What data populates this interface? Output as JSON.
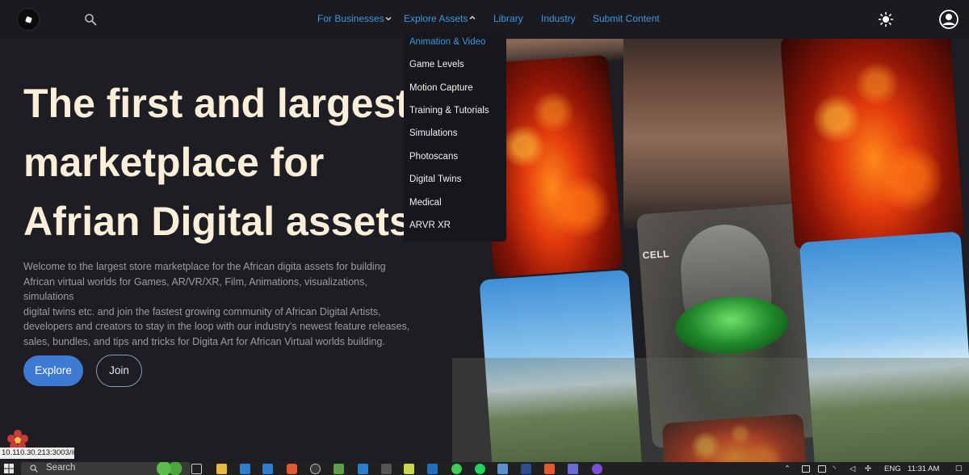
{
  "nav": {
    "links": [
      {
        "label": "For Businesses",
        "has_chevron": true,
        "chevron": "chevron-down-icon"
      },
      {
        "label": "Explore Assets",
        "has_chevron": true,
        "chevron": "chevron-up-icon"
      },
      {
        "label": "Library"
      },
      {
        "label": "Industry"
      },
      {
        "label": "Submit Content"
      }
    ],
    "link_color": "#3b98e0"
  },
  "dropdown": {
    "items": [
      {
        "label": "Animation & Video",
        "active": true
      },
      {
        "label": "Game Levels"
      },
      {
        "label": "Motion Capture"
      },
      {
        "label": "Training & Tutorials"
      },
      {
        "label": "Simulations"
      },
      {
        "label": "Photoscans"
      },
      {
        "label": "Digital Twins"
      },
      {
        "label": "Medical"
      },
      {
        "label": "ARVR XR"
      }
    ]
  },
  "hero": {
    "title_lines": [
      "The first and largest",
      "marketplace for",
      "Afrian Digital assets"
    ],
    "description_lines": [
      "Welcome to the largest store marketplace for the African digita assets for building",
      "African virtual worlds for Games, AR/VR/XR, Film, Animations, visualizations, simulations",
      "digital twins etc. and join the fastest growing community of African Digital Artists,",
      "developers and creators to stay in the loop with our industry's newest feature releases,",
      "sales, bundles, and tips and tricks for Digita Art for African Virtual worlds building."
    ],
    "explore_label": "Explore",
    "join_label": "Join",
    "title_color": "#fbefd9",
    "button_color": "#3d7bd2"
  },
  "gallery": {
    "robot_label": "CELL"
  },
  "browser": {
    "status_url": "10.110.30.213:3003/#"
  },
  "taskbar": {
    "search_placeholder": "Search",
    "language": "ENG",
    "time": "11:31 AM"
  }
}
